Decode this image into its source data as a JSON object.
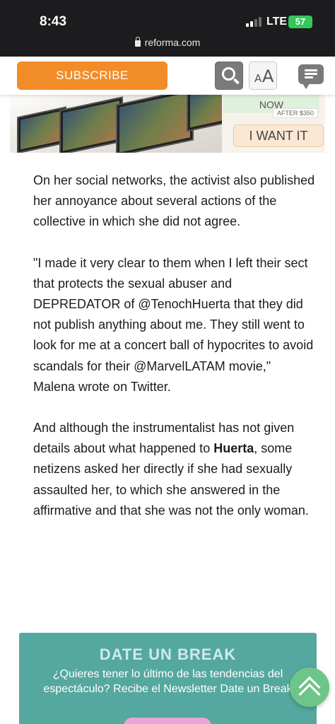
{
  "status_bar": {
    "time": "8:43",
    "network": "LTE",
    "battery": "57",
    "url": "reforma.com"
  },
  "header": {
    "subscribe_label": "SUBSCRIBE",
    "text_size_label": "AA",
    "icons": [
      "search-icon",
      "text-size-icon",
      "comments-icon"
    ]
  },
  "ad": {
    "now_label": "NOW",
    "after_label": "AFTER $350",
    "cta_label": "I WANT IT"
  },
  "article": {
    "paragraphs": [
      "On her social networks, the activist also published her annoyance about several actions of the collective in which she did not agree.",
      "\"I made it very clear to them when I left their sect that protects the sexual abuser and DEPREDATOR of @TenochHuerta that they did not publish anything about me. They still went to look for me at a concert ball of hypocrites to avoid scandals for their @MarvelLATAM movie,\" Malena wrote on Twitter."
    ],
    "p3_before": "And although the instrumentalist has not given details about what happened to ",
    "p3_bold": "Huerta",
    "p3_after": ", some netizens asked her directly if she had sexually assaulted her, to which she answered in the affirmative and that she was not the only woman."
  },
  "newsletter": {
    "title": "DATE UN BREAK",
    "text": "¿Quieres tener lo último de las tendencias del espectáculo? Recibe el Newsletter Date un Break"
  },
  "colors": {
    "subscribe": "#f28c28",
    "newsletter_bg": "#55a89f",
    "scroll_top": "#6dc58a"
  }
}
